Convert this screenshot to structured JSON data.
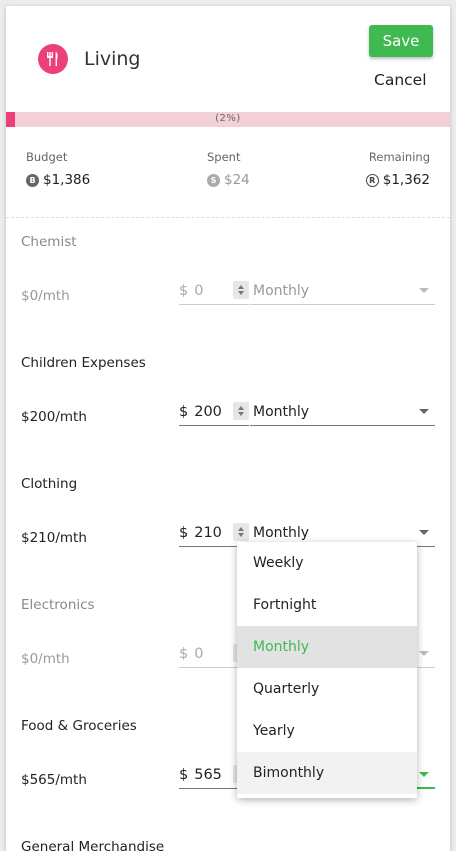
{
  "header": {
    "category_icon": "fork-knife-icon",
    "title": "Living",
    "save_label": "Save",
    "cancel_label": "Cancel",
    "accent_color": "#ec407a",
    "save_color": "#3fb950"
  },
  "progress": {
    "label": "(2%)",
    "fraction": 0.02
  },
  "summary": {
    "budget": {
      "label": "Budget",
      "badge": "B",
      "value": "$1,386"
    },
    "spent": {
      "label": "Spent",
      "badge": "S",
      "value": "$24"
    },
    "remaining": {
      "label": "Remaining",
      "badge": "R",
      "value": "$1,362"
    }
  },
  "rows": [
    {
      "name": "Chemist",
      "per_month": "$0/mth",
      "currency": "$",
      "amount": "0",
      "frequency": "Monthly"
    },
    {
      "name": "Children Expenses",
      "per_month": "$200/mth",
      "currency": "$",
      "amount": "200",
      "frequency": "Monthly"
    },
    {
      "name": "Clothing",
      "per_month": "$210/mth",
      "currency": "$",
      "amount": "210",
      "frequency": "Monthly"
    },
    {
      "name": "Electronics",
      "per_month": "$0/mth",
      "currency": "$",
      "amount": "0",
      "frequency": ""
    },
    {
      "name": "Food & Groceries",
      "per_month": "$565/mth",
      "currency": "$",
      "amount": "565",
      "frequency": ""
    },
    {
      "name": "General Merchandise"
    }
  ],
  "dropdown": {
    "options": [
      "Weekly",
      "Fortnight",
      "Monthly",
      "Quarterly",
      "Yearly",
      "Bimonthly"
    ],
    "selected": "Monthly"
  }
}
